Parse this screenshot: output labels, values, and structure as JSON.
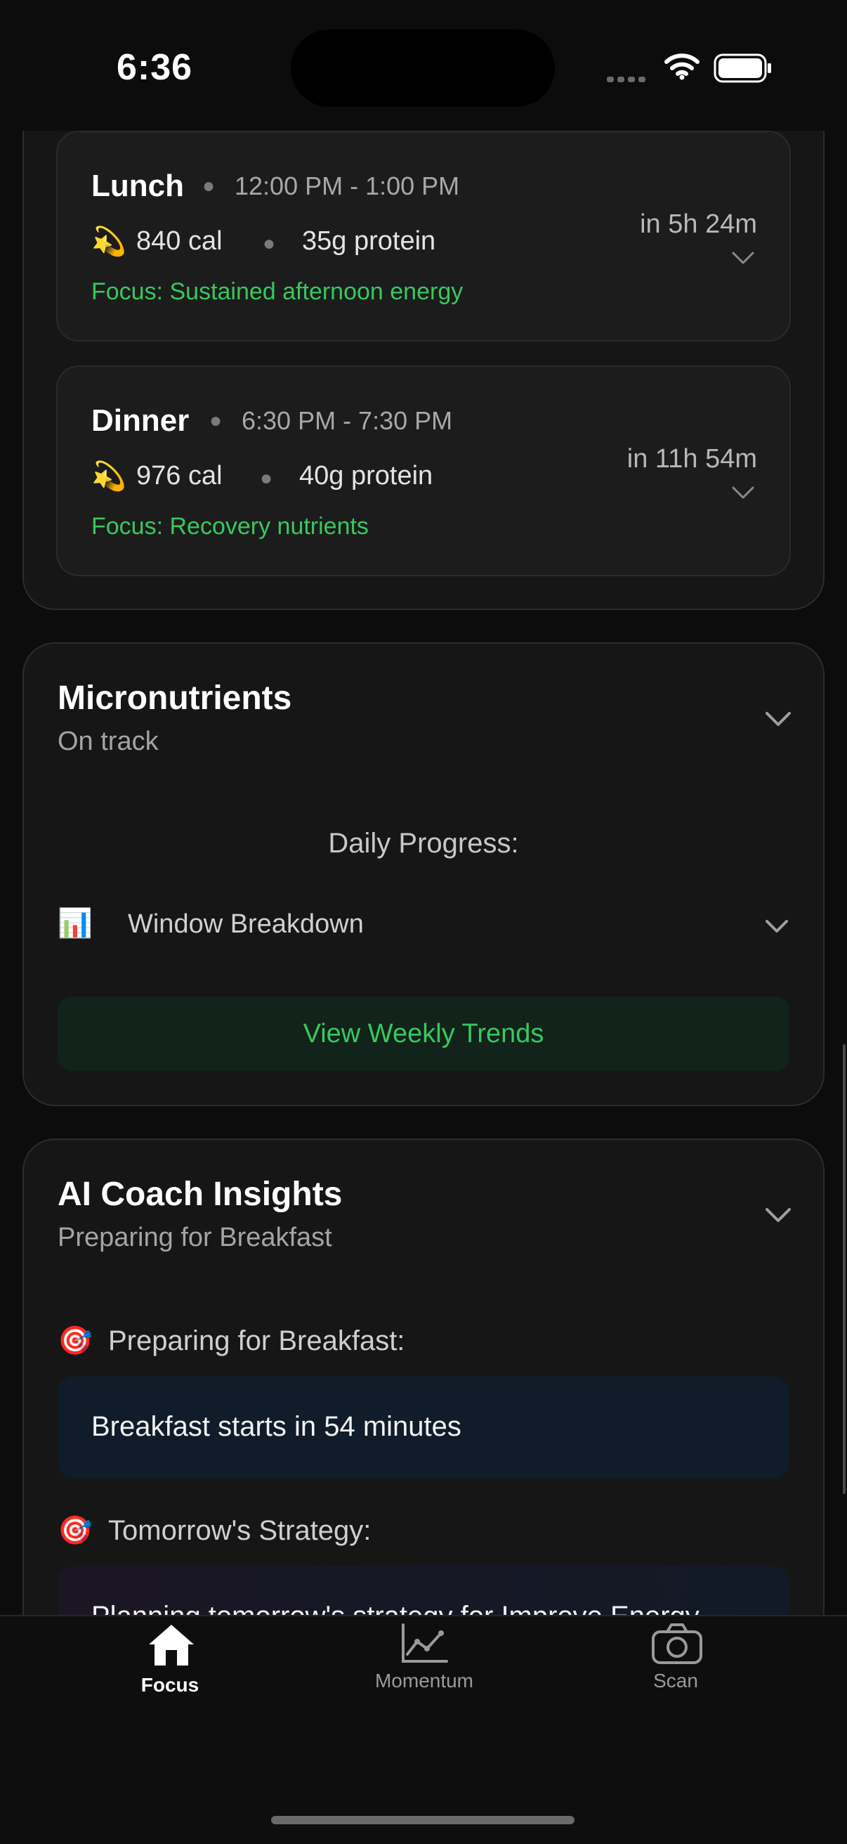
{
  "status_bar": {
    "time": "6:36"
  },
  "meals": [
    {
      "name": "Lunch",
      "time": "12:00 PM - 1:00 PM",
      "emoji": "💫",
      "calories": "840 cal",
      "protein": "35g protein",
      "focus": "Focus: Sustained afternoon energy",
      "eta": "in 5h 24m"
    },
    {
      "name": "Dinner",
      "time": "6:30 PM - 7:30 PM",
      "emoji": "💫",
      "calories": "976 cal",
      "protein": "40g protein",
      "focus": "Focus: Recovery nutrients",
      "eta": "in 11h 54m"
    }
  ],
  "micronutrients": {
    "title": "Micronutrients",
    "subtitle": "On track",
    "daily_progress": "Daily Progress:",
    "breakdown_emoji": "📊",
    "breakdown_label": "Window Breakdown",
    "trends_button": "View Weekly Trends"
  },
  "coach": {
    "title": "AI Coach Insights",
    "subtitle": "Preparing for Breakfast",
    "section1_emoji": "🎯",
    "section1_label": "Preparing for Breakfast:",
    "section1_text": "Breakfast starts in 54 minutes",
    "section2_emoji": "🎯",
    "section2_label": "Tomorrow's Strategy:",
    "section2_text": "Planning tomorrow's strategy for Improve Energy"
  },
  "nav": {
    "items": [
      {
        "label": "Focus",
        "icon": "home-icon",
        "active": true
      },
      {
        "label": "Momentum",
        "icon": "chart-icon",
        "active": false
      },
      {
        "label": "Scan",
        "icon": "camera-icon",
        "active": false
      }
    ]
  },
  "colors": {
    "accent_green": "#38c85f",
    "background": "#0c0c0c",
    "card": "#161616"
  }
}
